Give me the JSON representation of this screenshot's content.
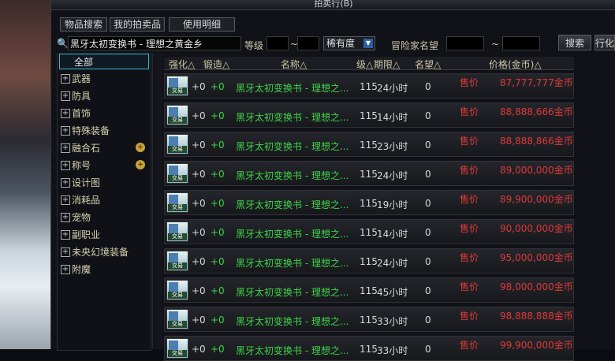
{
  "window": {
    "title": "拍卖行(B)"
  },
  "tabs": [
    "物品搜索",
    "我的拍卖品",
    "使用明细"
  ],
  "search": {
    "query": "黑牙太初变换书 - 理想之黄金乡",
    "level_label": "等级",
    "range_sep": "~",
    "rarity_label": "稀有度",
    "adventurer_label": "冒险家名望",
    "search_button": "搜索",
    "extra_button": "行化"
  },
  "sidebar": {
    "items": [
      {
        "label": "全部"
      },
      {
        "label": "武器"
      },
      {
        "label": "防具"
      },
      {
        "label": "首饰"
      },
      {
        "label": "特殊装备"
      },
      {
        "label": "融合石"
      },
      {
        "label": "称号"
      },
      {
        "label": "设计图"
      },
      {
        "label": "消耗品"
      },
      {
        "label": "宠物"
      },
      {
        "label": "副职业"
      },
      {
        "label": "未央幻境装备"
      },
      {
        "label": "附魔"
      }
    ]
  },
  "table": {
    "headers": {
      "enhance": "强化△",
      "forge": "锻造△",
      "name": "名称△",
      "level": "级△",
      "period": "期限△",
      "fame": "名望△",
      "price": "价格(金币)△"
    },
    "icon_label": "交易",
    "rows": [
      {
        "enhance": "+0",
        "forge": "+0",
        "name": "黑牙太初变换书 - 理想之...",
        "level": "115",
        "period": "24小时",
        "fame": "0",
        "price_label": "售价",
        "price": "87,777,777金币"
      },
      {
        "enhance": "+0",
        "forge": "+0",
        "name": "黑牙太初变换书 - 理想之...",
        "level": "115",
        "period": "14小时",
        "fame": "0",
        "price_label": "售价",
        "price": "88,888,666金币"
      },
      {
        "enhance": "+0",
        "forge": "+0",
        "name": "黑牙太初变换书 - 理想之...",
        "level": "115",
        "period": "23小时",
        "fame": "0",
        "price_label": "售价",
        "price": "88,888,866金币"
      },
      {
        "enhance": "+0",
        "forge": "+0",
        "name": "黑牙太初变换书 - 理想之...",
        "level": "115",
        "period": "24小时",
        "fame": "0",
        "price_label": "售价",
        "price": "89,000,000金币"
      },
      {
        "enhance": "+0",
        "forge": "+0",
        "name": "黑牙太初变换书 - 理想之...",
        "level": "115",
        "period": "19小时",
        "fame": "0",
        "price_label": "售价",
        "price": "89,900,000金币"
      },
      {
        "enhance": "+0",
        "forge": "+0",
        "name": "黑牙太初变换书 - 理想之...",
        "level": "115",
        "period": "14小时",
        "fame": "0",
        "price_label": "售价",
        "price": "90,000,000金币"
      },
      {
        "enhance": "+0",
        "forge": "+0",
        "name": "黑牙太初变换书 - 理想之...",
        "level": "115",
        "period": "24小时",
        "fame": "0",
        "price_label": "售价",
        "price": "95,000,000金币"
      },
      {
        "enhance": "+0",
        "forge": "+0",
        "name": "黑牙太初变换书 - 理想之...",
        "level": "115",
        "period": "45小时",
        "fame": "0",
        "price_label": "售价",
        "price": "98,000,000金币"
      },
      {
        "enhance": "+0",
        "forge": "+0",
        "name": "黑牙太初变换书 - 理想之...",
        "level": "115",
        "period": "33小时",
        "fame": "0",
        "price_label": "售价",
        "price": "98,888,888金币"
      },
      {
        "enhance": "+0",
        "forge": "+0",
        "name": "黑牙太初变换书 - 理想之...",
        "level": "115",
        "period": "33小时",
        "fame": "0",
        "price_label": "售价",
        "price": "99,900,000金币"
      }
    ]
  },
  "colors": {
    "accent": "#3fb7d4",
    "enhance_green": "#3fd34a",
    "price_red": "#e03838"
  }
}
